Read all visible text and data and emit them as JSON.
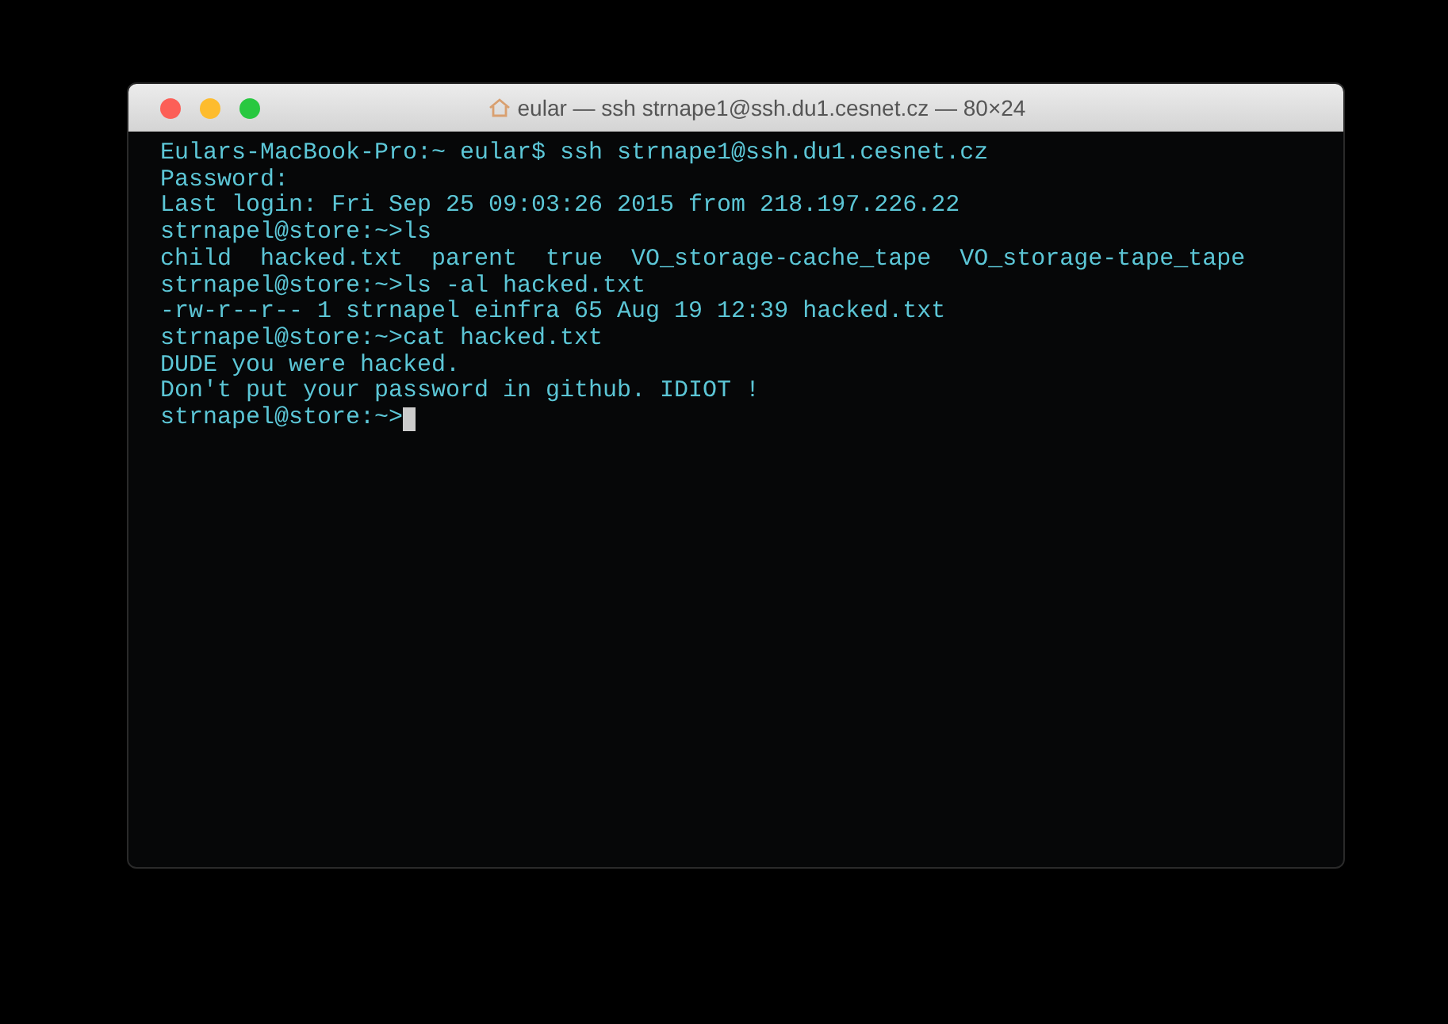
{
  "window": {
    "title": "eular — ssh strnape1@ssh.du1.cesnet.cz — 80×24"
  },
  "terminal": {
    "lines": [
      "Eulars-MacBook-Pro:~ eular$ ssh strnape1@ssh.du1.cesnet.cz",
      "Password:",
      "Last login: Fri Sep 25 09:03:26 2015 from 218.197.226.22",
      "strnapel@store:~>ls",
      "child  hacked.txt  parent  true  VO_storage-cache_tape  VO_storage-tape_tape",
      "strnapel@store:~>ls -al hacked.txt",
      "-rw-r--r-- 1 strnapel einfra 65 Aug 19 12:39 hacked.txt",
      "strnapel@store:~>cat hacked.txt",
      "DUDE you were hacked.",
      "Don't put your password in github. IDIOT !",
      "strnapel@store:~>"
    ],
    "cursor": true
  }
}
